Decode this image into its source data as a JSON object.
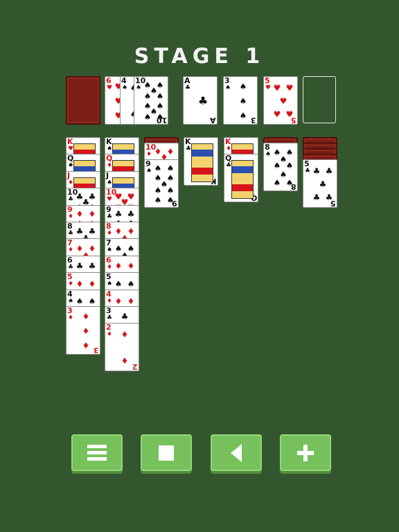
{
  "header": {
    "title": "STAGE 1"
  },
  "colors": {
    "felt": "#34562f",
    "card_back": "#7a1d15",
    "red_suit": "#d6141a",
    "black_suit": "#111111",
    "button": "#77c15c"
  },
  "stock": {
    "face_down": true
  },
  "waste": [
    {
      "rank": "6",
      "suit": "♥",
      "color": "red"
    },
    {
      "rank": "4",
      "suit": "♠",
      "color": "black"
    },
    {
      "rank": "10",
      "suit": "♠",
      "color": "black"
    }
  ],
  "foundations": [
    {
      "rank": "A",
      "suit": "♣",
      "color": "black"
    },
    {
      "rank": "3",
      "suit": "♠",
      "color": "black"
    },
    {
      "rank": "5",
      "suit": "♥",
      "color": "red"
    },
    {
      "rank": "",
      "suit": "",
      "color": "",
      "empty": true
    }
  ],
  "tableau": [
    {
      "hidden": 0,
      "cards": [
        {
          "rank": "K",
          "suit": "♥",
          "color": "red"
        },
        {
          "rank": "Q",
          "suit": "♠",
          "color": "black"
        },
        {
          "rank": "J",
          "suit": "♦",
          "color": "red"
        },
        {
          "rank": "10",
          "suit": "♣",
          "color": "black"
        },
        {
          "rank": "9",
          "suit": "♦",
          "color": "red"
        },
        {
          "rank": "8",
          "suit": "♣",
          "color": "black"
        },
        {
          "rank": "7",
          "suit": "♦",
          "color": "red"
        },
        {
          "rank": "6",
          "suit": "♣",
          "color": "black"
        },
        {
          "rank": "5",
          "suit": "♦",
          "color": "red"
        },
        {
          "rank": "4",
          "suit": "♠",
          "color": "black"
        },
        {
          "rank": "3",
          "suit": "♦",
          "color": "red"
        }
      ]
    },
    {
      "hidden": 0,
      "cards": [
        {
          "rank": "K",
          "suit": "♠",
          "color": "black"
        },
        {
          "rank": "Q",
          "suit": "♦",
          "color": "red"
        },
        {
          "rank": "J",
          "suit": "♠",
          "color": "black"
        },
        {
          "rank": "10",
          "suit": "♥",
          "color": "red"
        },
        {
          "rank": "9",
          "suit": "♣",
          "color": "black"
        },
        {
          "rank": "8",
          "suit": "♦",
          "color": "red"
        },
        {
          "rank": "7",
          "suit": "♠",
          "color": "black"
        },
        {
          "rank": "6",
          "suit": "♦",
          "color": "red"
        },
        {
          "rank": "5",
          "suit": "♠",
          "color": "black"
        },
        {
          "rank": "4",
          "suit": "♦",
          "color": "red"
        },
        {
          "rank": "3",
          "suit": "♣",
          "color": "black"
        },
        {
          "rank": "2",
          "suit": "♦",
          "color": "red"
        }
      ]
    },
    {
      "hidden": 1,
      "cards": [
        {
          "rank": "10",
          "suit": "♦",
          "color": "red"
        },
        {
          "rank": "9",
          "suit": "♠",
          "color": "black"
        }
      ]
    },
    {
      "hidden": 0,
      "cards": [
        {
          "rank": "K",
          "suit": "♣",
          "color": "black"
        }
      ]
    },
    {
      "hidden": 0,
      "cards": [
        {
          "rank": "K",
          "suit": "♦",
          "color": "red"
        },
        {
          "rank": "Q",
          "suit": "♣",
          "color": "black"
        }
      ]
    },
    {
      "hidden": 1,
      "cards": [
        {
          "rank": "8",
          "suit": "♠",
          "color": "black"
        }
      ]
    },
    {
      "hidden": 4,
      "cards": [
        {
          "rank": "5",
          "suit": "♣",
          "color": "black"
        }
      ]
    }
  ],
  "toolbar": {
    "buttons": [
      {
        "name": "menu-button",
        "icon": "menu-icon"
      },
      {
        "name": "stop-button",
        "icon": "stop-icon"
      },
      {
        "name": "undo-button",
        "icon": "back-arrow-icon"
      },
      {
        "name": "new-game-button",
        "icon": "plus-icon"
      }
    ]
  }
}
